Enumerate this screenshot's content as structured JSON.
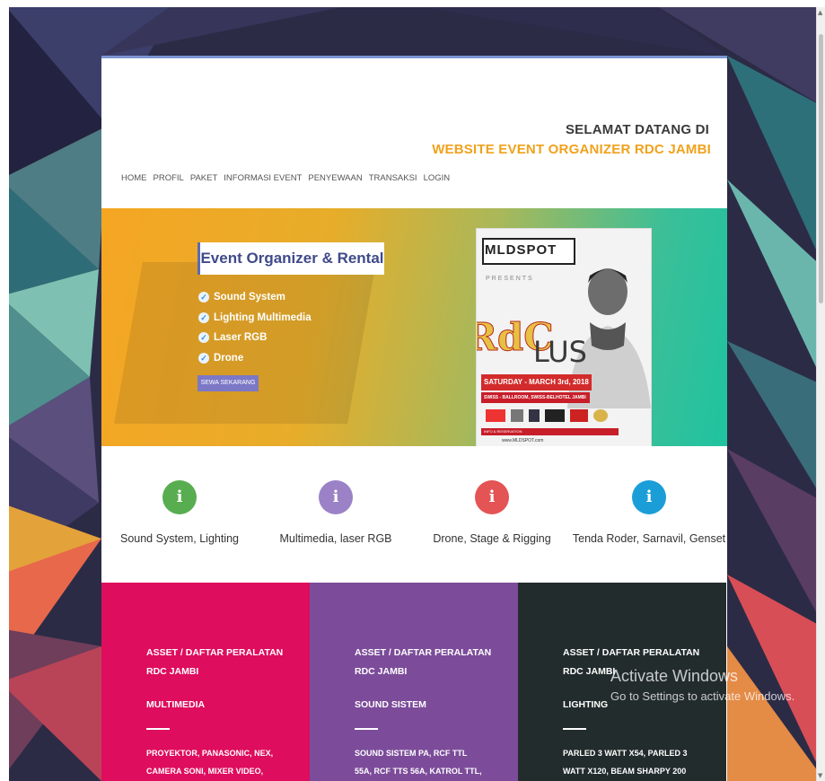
{
  "header": {
    "welcome_line1": "SELAMAT DATANG DI",
    "welcome_line2": "WEBSITE EVENT ORGANIZER RDC JAMBI"
  },
  "nav": {
    "items": [
      "HOME",
      "PROFIL",
      "PAKET",
      "INFORMASI EVENT",
      "PENYEWAAN",
      "TRANSAKSI",
      "LOGIN"
    ]
  },
  "hero": {
    "title": "Event Organizer & Rental",
    "features": [
      "Sound System",
      "Lighting Multimedia",
      "Laser RGB",
      "Drone"
    ],
    "button_label": "SEWA SEKARANG",
    "poster": {
      "brand": "MLDSPOT",
      "presents": "PRESENTS",
      "logo_text_1": "RdC",
      "logo_text_2": "LUS",
      "date": "SATURDAY - MARCH 3rd, 2018",
      "venue": "SWISS - BALLROOM, SWISS-BELHOTEL JAMBI",
      "info": "INFO & RESERVATION",
      "url": "www.MLDSPOT.com"
    }
  },
  "services": [
    {
      "label": "Sound System, Lighting",
      "color": "#57ad4f"
    },
    {
      "label": "Multimedia, laser RGB",
      "color": "#9b82c7"
    },
    {
      "label": "Drone, Stage & Rigging",
      "color": "#e45454"
    },
    {
      "label": "Tenda Roder, Sarnavil, Genset",
      "color": "#1b9ed8"
    }
  ],
  "service_icon_glyph": "i",
  "assets": [
    {
      "heading_1": "ASSET / DAFTAR PERALATAN",
      "heading_2": "RDC JAMBI",
      "category": "MULTIMEDIA",
      "items_1": "PROYEKTOR, PANASONIC, NEX,",
      "items_2": "CAMERA SONI, MIXER VIDEO,",
      "color": "#de0d5e"
    },
    {
      "heading_1": "ASSET / DAFTAR PERALATAN",
      "heading_2": "RDC JAMBI",
      "category": "SOUND SISTEM",
      "items_1": "SOUND SISTEM PA, RCF TTL",
      "items_2": "55A, RCF TTS 56A, KATROL TTL,",
      "color": "#7c4c9a"
    },
    {
      "heading_1": "ASSET / DAFTAR PERALATAN",
      "heading_2": "RDC JAMBI",
      "category": "LIGHTING",
      "items_1": "PARLED 3 WATT X54, PARLED 3",
      "items_2": "WATT X120, BEAM SHARPY 200",
      "color": "#232c2c"
    }
  ],
  "overlay": {
    "activate_title": "Activate Windows",
    "activate_sub": "Go to Settings to activate Windows."
  },
  "check_glyph": "✓",
  "scroll_up_glyph": "▲",
  "scroll_down_glyph": "▼"
}
